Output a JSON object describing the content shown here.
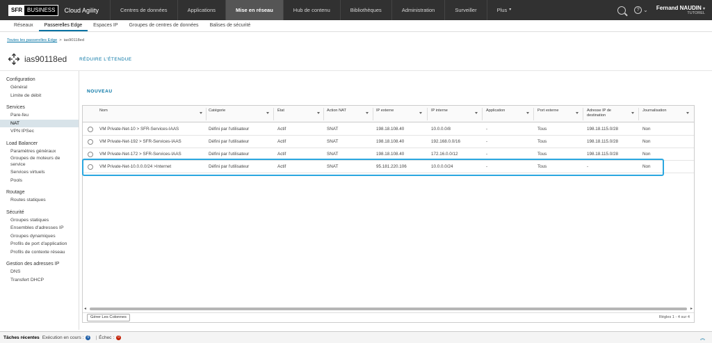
{
  "topbar": {
    "logo_sfr": "SFR",
    "logo_business": "BUSINESS",
    "app_name": "Cloud Agility",
    "tabs": [
      {
        "label": "Centres de données"
      },
      {
        "label": "Applications"
      },
      {
        "label": "Mise en réseau",
        "active": true
      },
      {
        "label": "Hub de contenu"
      },
      {
        "label": "Bibliothèques"
      },
      {
        "label": "Administration"
      },
      {
        "label": "Surveiller"
      },
      {
        "label": "Plus"
      }
    ],
    "help_caret": "⌄",
    "user_name": "Fernand NAUDIN",
    "user_role": "TUTOREL"
  },
  "subnav": [
    {
      "label": "Réseaux"
    },
    {
      "label": "Passerelles Edge",
      "active": true
    },
    {
      "label": "Espaces IP"
    },
    {
      "label": "Groupes de centres de données"
    },
    {
      "label": "Balises de sécurité"
    }
  ],
  "breadcrumb": {
    "link": "Toutes les passerelles Edge",
    "separator": ">",
    "current": "ias90118ed"
  },
  "page": {
    "title": "ias90118ed",
    "collapse": "RÉDUIRE L'ÉTENDUE",
    "new_label": "NOUVEAU"
  },
  "sidebar": [
    {
      "head": "Configuration",
      "items": [
        {
          "label": "Général"
        },
        {
          "label": "Limite de débit"
        }
      ]
    },
    {
      "head": "Services",
      "items": [
        {
          "label": "Pare-feu"
        },
        {
          "label": "NAT",
          "active": true
        },
        {
          "label": "VPN IPSec"
        }
      ]
    },
    {
      "head": "Load Balancer",
      "items": [
        {
          "label": "Paramètres généraux"
        },
        {
          "label": "Groupes de moteurs de service"
        },
        {
          "label": "Services virtuels"
        },
        {
          "label": "Pools"
        }
      ]
    },
    {
      "head": "Routage",
      "items": [
        {
          "label": "Routes statiques"
        }
      ]
    },
    {
      "head": "Sécurité",
      "items": [
        {
          "label": "Groupes statiques"
        },
        {
          "label": "Ensembles d'adresses IP"
        },
        {
          "label": "Groupes dynamiques"
        },
        {
          "label": "Profils de port d'application"
        },
        {
          "label": "Profils de contexte réseau"
        }
      ]
    },
    {
      "head": "Gestion des adresses IP",
      "items": [
        {
          "label": "DNS"
        },
        {
          "label": "Transfert DHCP"
        }
      ]
    }
  ],
  "table": {
    "columns": [
      "Nom",
      "Catégorie",
      "État",
      "Action NAT",
      "IP externe",
      "IP interne",
      "Application",
      "Port externe",
      "Adresse IP de destination",
      "Journalisation"
    ],
    "rows": [
      [
        "VM Private-Net-10 > SFR-Services-IAAS",
        "Défini par l'utilisateur",
        "Actif",
        "SNAT",
        "198.18.108.40",
        "10.0.0.0/8",
        "-",
        "Tous",
        "198.18.115.0/28",
        "Non"
      ],
      [
        "VM Private-Net-192 > SFR-Services-IAAS",
        "Défini par l'utilisateur",
        "Actif",
        "SNAT",
        "198.18.108.40",
        "192.168.0.0/16",
        "-",
        "Tous",
        "198.18.115.0/28",
        "Non"
      ],
      [
        "VM Private-Net-172 > SFR-Services-IAAS",
        "Défini par l'utilisateur",
        "Actif",
        "SNAT",
        "198.18.108.40",
        "172.16.0.0/12",
        "-",
        "Tous",
        "198.18.115.0/28",
        "Non"
      ],
      [
        "VM Private-Net-10.0.0.0/24 >Internet",
        "Défini par l'utilisateur",
        "Actif",
        "SNAT",
        "95.181.220.106",
        "10.0.0.0/24",
        "-",
        "Tous",
        "-",
        "Non"
      ]
    ],
    "manage_columns": "Gérer Les Colonnes",
    "pager": "Règles 1 - 4 sur 4"
  },
  "tasks": {
    "title": "Tâches récentes",
    "running_label": "Exécution en cours :",
    "running_count": "0",
    "separator": "|",
    "failed_label": "Échec :",
    "failed_count": "0"
  },
  "colors": {
    "accent": "#0072a3",
    "highlight": "#2aa7e0",
    "topbar": "#313131"
  }
}
